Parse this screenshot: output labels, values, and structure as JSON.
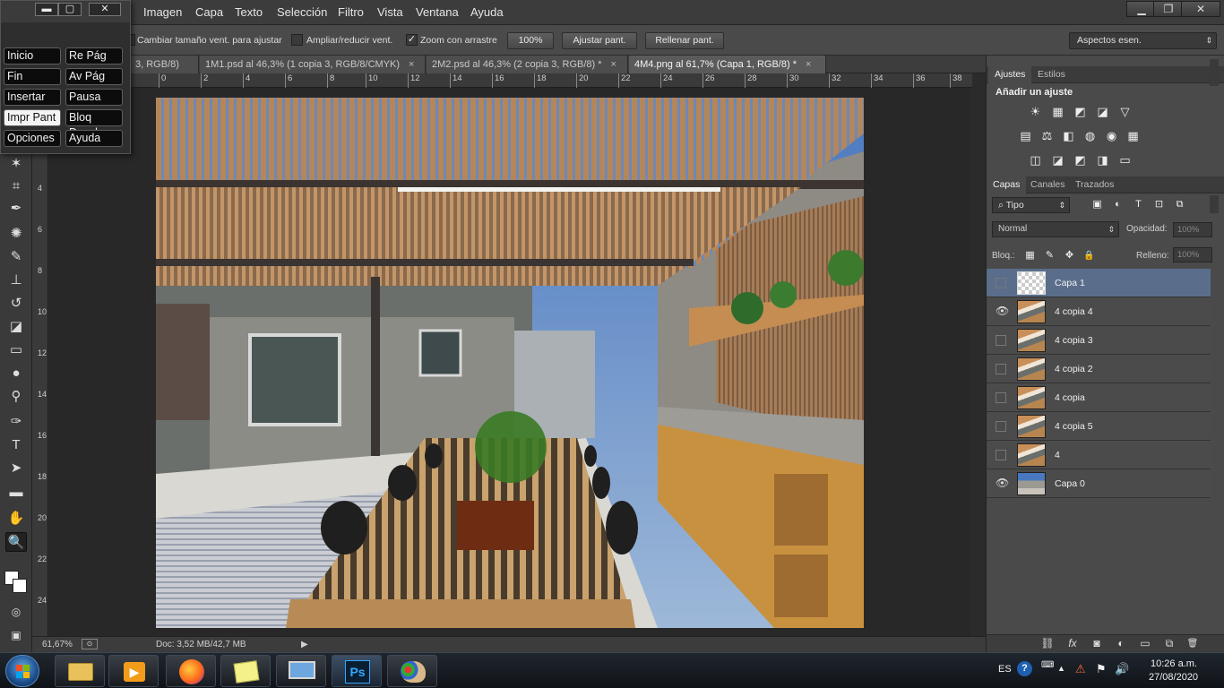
{
  "menu": [
    "Imagen",
    "Capa",
    "Texto",
    "Selección",
    "Filtro",
    "Vista",
    "Ventana",
    "Ayuda"
  ],
  "window_controls": {
    "minimize": "▁",
    "restore": "❐",
    "close": "✕"
  },
  "options": {
    "resize_windows": {
      "label": "Cambiar tamaño vent. para ajustar",
      "checked": false
    },
    "zoom_all": {
      "label": "Ampliar/reducir vent.",
      "checked": false
    },
    "scrubby_zoom": {
      "label": "Zoom con arrastre",
      "checked": true,
      "mark": "✓"
    },
    "btn_100": "100%",
    "btn_fit": "Ajustar pant.",
    "btn_fill": "Rellenar pant.",
    "workspace": "Aspectos esen."
  },
  "doc_tabs": [
    {
      "label": "3, RGB/8)",
      "close": ""
    },
    {
      "label": "1M1.psd al 46,3% (1 copia 3, RGB/8/CMYK)",
      "close": "×"
    },
    {
      "label": "2M2.psd al 46,3% (2 copia 3, RGB/8) *",
      "close": "×"
    },
    {
      "label": "4M4.png al 61,7% (Capa 1, RGB/8) *",
      "close": "×"
    }
  ],
  "ruler_top": [
    "0",
    "2",
    "4",
    "6",
    "8",
    "10",
    "12",
    "14",
    "16",
    "18",
    "20",
    "22",
    "24",
    "26",
    "28",
    "30",
    "32",
    "34",
    "36",
    "38"
  ],
  "ruler_left": [
    "4",
    "6",
    "8",
    "10",
    "12",
    "14",
    "16",
    "18",
    "20",
    "22",
    "24"
  ],
  "keyboard": {
    "controls": {
      "minimize": "▬",
      "restore": "▢",
      "close": "✕"
    },
    "keys": [
      {
        "label": "Inicio",
        "lit": false
      },
      {
        "label": "Re Pág",
        "lit": false
      },
      {
        "label": "Fin",
        "lit": false
      },
      {
        "label": "Av Pág",
        "lit": false
      },
      {
        "label": "Insertar",
        "lit": false
      },
      {
        "label": "Pausa",
        "lit": false
      },
      {
        "label": "Impr Pant",
        "lit": true
      },
      {
        "label": "Bloq Despl",
        "lit": false
      },
      {
        "label": "Opciones",
        "lit": false
      },
      {
        "label": "Ayuda",
        "lit": false
      }
    ]
  },
  "status": {
    "zoom": "61,67%",
    "doc": "Doc: 3,52 MB/42,7 MB",
    "arrow": "▶"
  },
  "adjustments": {
    "tabs": [
      "Ajustes",
      "Estilos"
    ],
    "title": "Añadir un ajuste",
    "row1": [
      "☀",
      "▦",
      "◩",
      "◪",
      "▽"
    ],
    "row2": [
      "▤",
      "⚖",
      "◧",
      "◍",
      "◉",
      "▦"
    ],
    "row3": [
      "◫",
      "◪",
      "◩",
      "◨",
      "▭"
    ]
  },
  "layers": {
    "tabs": [
      "Capas",
      "Canales",
      "Trazados"
    ],
    "filter": "Tipo",
    "filter_icon": "⌕",
    "filter_icons": [
      "▣",
      "◐",
      "T",
      "⊡",
      "⧉"
    ],
    "blend_mode": "Normal",
    "opacity_label": "Opacidad:",
    "opacity": "100%",
    "lock_label": "Bloq.:",
    "lock_icons": [
      "▦",
      "✎",
      "✥",
      "🔒"
    ],
    "fill_label": "Relleno:",
    "fill": "100%",
    "items": [
      {
        "name": "Capa 1",
        "visible": false,
        "selected": true,
        "thumb": "transparent"
      },
      {
        "name": "4 copia 4",
        "visible": true,
        "selected": false,
        "thumb": "photo"
      },
      {
        "name": "4 copia 3",
        "visible": false,
        "selected": false,
        "thumb": "photo"
      },
      {
        "name": "4 copia 2",
        "visible": false,
        "selected": false,
        "thumb": "photo"
      },
      {
        "name": "4 copia",
        "visible": false,
        "selected": false,
        "thumb": "photo"
      },
      {
        "name": "4 copia 5",
        "visible": false,
        "selected": false,
        "thumb": "photo"
      },
      {
        "name": "4",
        "visible": false,
        "selected": false,
        "thumb": "photo"
      },
      {
        "name": "Capa 0",
        "visible": true,
        "selected": false,
        "thumb": "house"
      }
    ],
    "footer_icons": [
      "⛓",
      "fx",
      "◙",
      "◐",
      "▭",
      "⧉",
      "🗑"
    ]
  },
  "taskbar": {
    "apps": [
      "explorer",
      "media-player",
      "firefox",
      "sticky-notes",
      "remote-desktop",
      "photoshop",
      "paint"
    ],
    "ps_label": "Ps",
    "lang": "ES",
    "time": "10:26 a.m.",
    "date": "27/08/2020"
  },
  "colors": {
    "panel": "#4a4a4a",
    "selected_layer": "#5a6e8c",
    "bg": "#2b2b2b"
  }
}
